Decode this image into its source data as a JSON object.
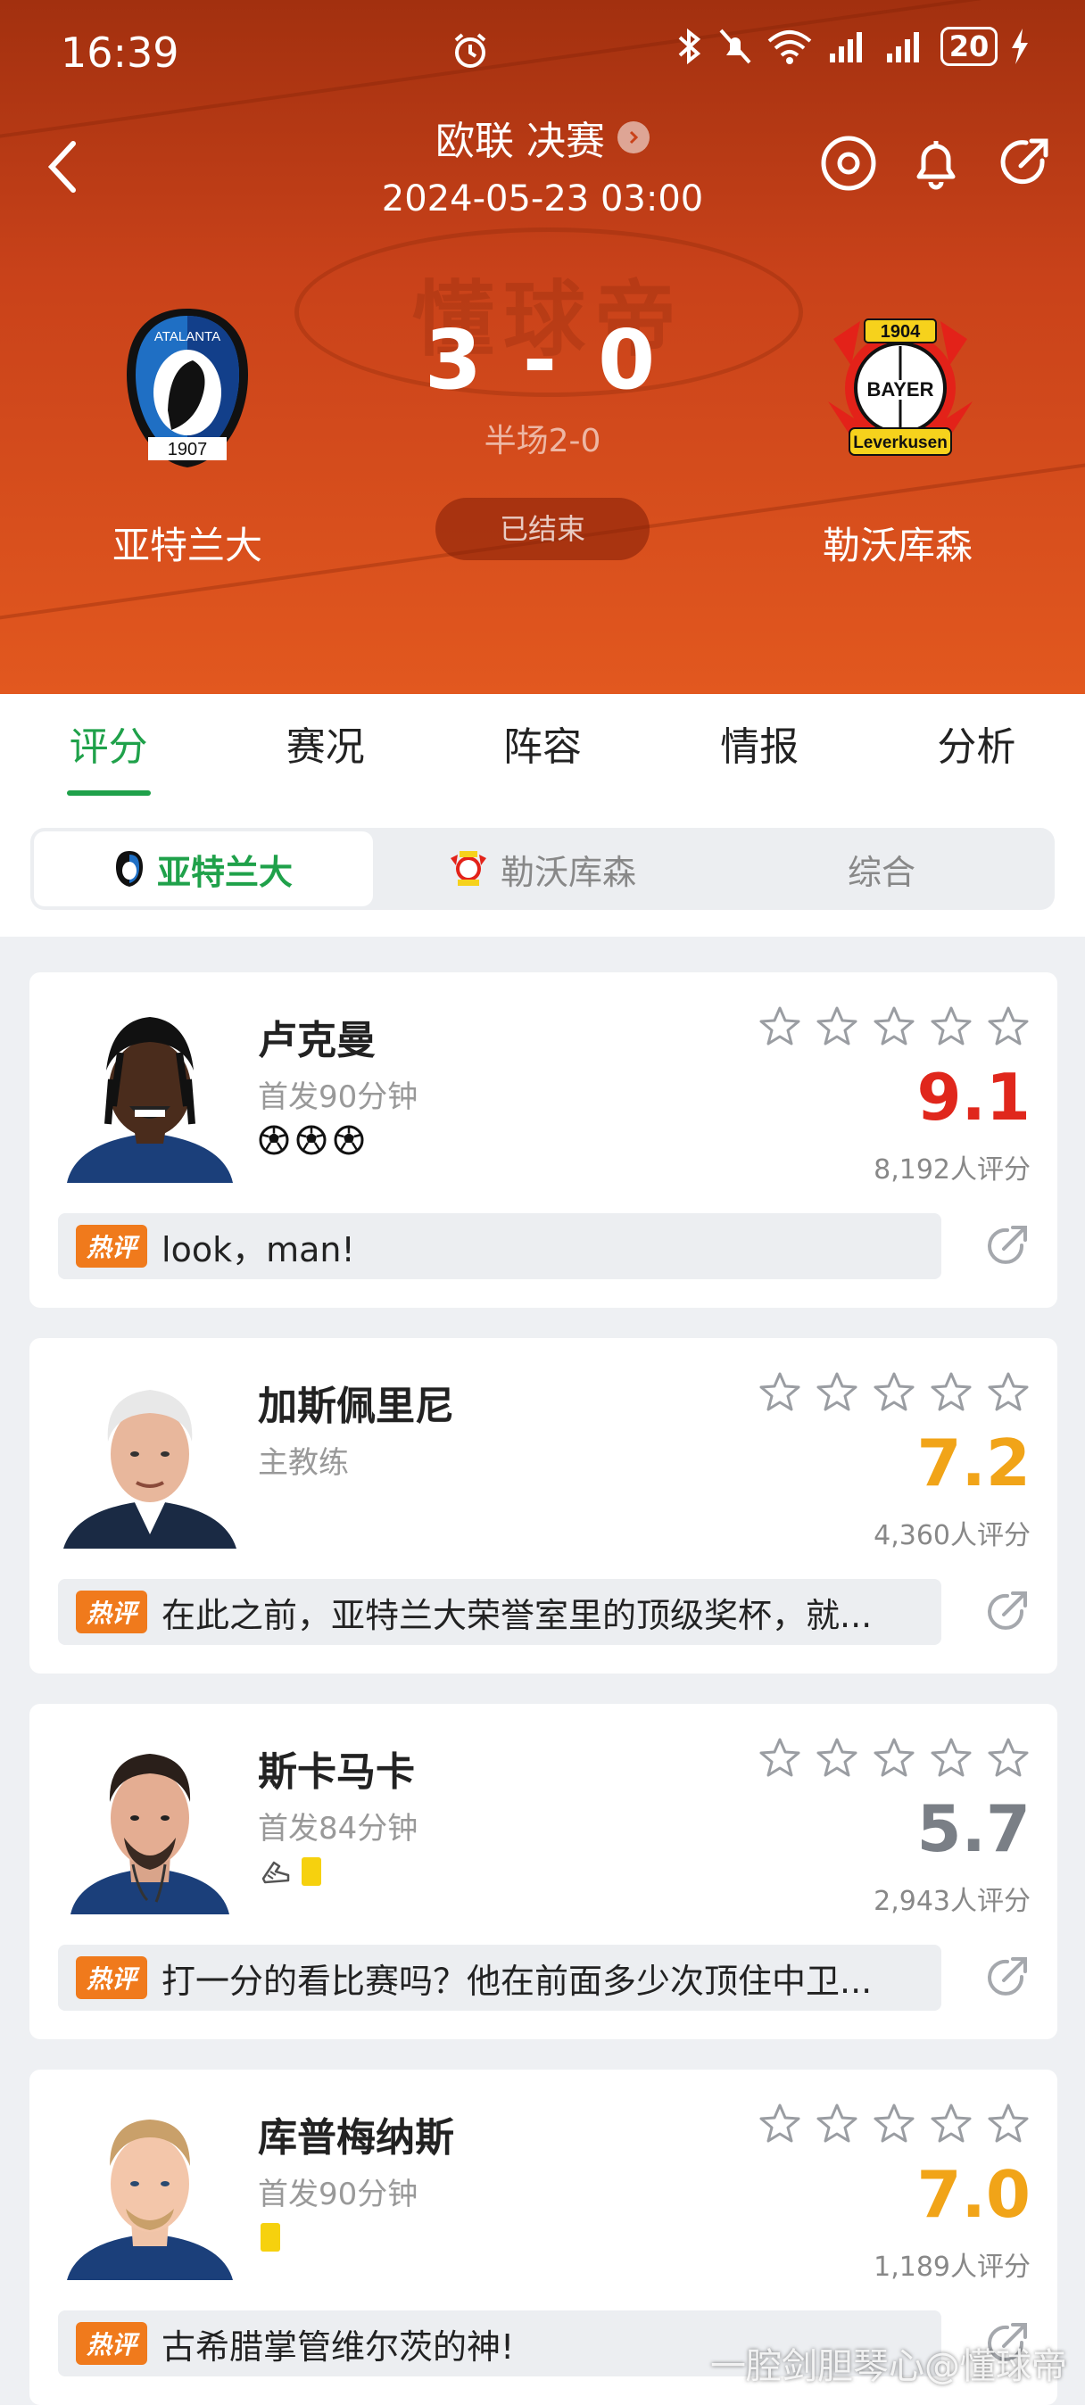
{
  "status_bar": {
    "time": "16:39",
    "battery": "20"
  },
  "header": {
    "competition": "欧联 决赛",
    "date": "2024-05-23 03:00",
    "watermark": "懂球帝",
    "home": {
      "name": "亚特兰大",
      "logo_top": "ATALANTA",
      "logo_year": "1907",
      "score": "3"
    },
    "away": {
      "name": "勒沃库森",
      "logo_year": "1904",
      "logo_text": "BAYER",
      "logo_bottom": "Leverkusen",
      "score": "0"
    },
    "score_separator": "-",
    "halftime": "半场2-0",
    "status": "已结束"
  },
  "tabs": [
    "评分",
    "赛况",
    "阵容",
    "情报",
    "分析"
  ],
  "active_tab": "评分",
  "subtabs": [
    "亚特兰大",
    "勒沃库森",
    "综合"
  ],
  "hot_label": "热评",
  "players": [
    {
      "name": "卢克曼",
      "role": "首发90分钟",
      "rating": "9.1",
      "rating_color": "#e0271c",
      "count": "8,192人评分",
      "comment": "look，man!",
      "events": [
        "goal",
        "goal",
        "goal"
      ]
    },
    {
      "name": "加斯佩里尼",
      "role": "主教练",
      "rating": "7.2",
      "rating_color": "#f1a418",
      "count": "4,360人评分",
      "comment": "在此之前，亚特兰大荣誉室里的顶级奖杯，就...",
      "events": []
    },
    {
      "name": "斯卡马卡",
      "role": "首发84分钟",
      "rating": "5.7",
      "rating_color": "#7a7f86",
      "count": "2,943人评分",
      "comment": "打一分的看比赛吗？他在前面多少次顶住中卫...",
      "events": [
        "boot",
        "yellow-card"
      ]
    },
    {
      "name": "库普梅纳斯",
      "role": "首发90分钟",
      "rating": "7.0",
      "rating_color": "#f1a418",
      "count": "1,189人评分",
      "comment": "古希腊掌管维尔茨的神!",
      "events": [
        "yellow-card"
      ]
    }
  ],
  "bottom_watermark": "一腔剑胆琴心@懂球帝",
  "colors": {
    "accent_green": "#1fa14a",
    "header_orange": "#d84e1c"
  }
}
